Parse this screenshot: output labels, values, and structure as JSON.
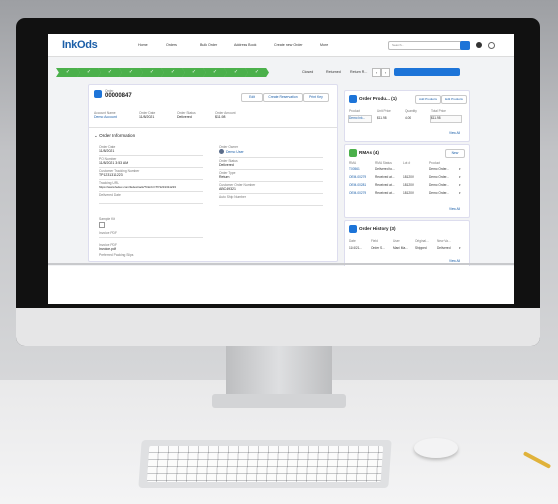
{
  "app": {
    "logo": "InkOds"
  },
  "nav": {
    "items": [
      "Home",
      "Orders",
      "Bulk Order",
      "Address Book",
      "Create new Order",
      "More"
    ],
    "search_placeholder": "Search..."
  },
  "path": {
    "stages": [
      "✓",
      "✓",
      "✓",
      "✓",
      "✓",
      "✓",
      "✓",
      "✓",
      "✓",
      "✓"
    ],
    "status_closed": "Closed",
    "status_returned": "Returned",
    "status_return": "Return R..."
  },
  "order": {
    "object_label": "Order",
    "number": "00000847",
    "actions": [
      "Edit",
      "Create Reservation",
      "Print Key"
    ],
    "account_name_label": "Account Name",
    "account_name": "Demo Account",
    "order_date_label": "Order Date",
    "order_date": "11/8/2021",
    "order_status_label": "Order Status",
    "order_status": "Delivered",
    "order_amount_label": "Order Amount",
    "order_amount": "$11.98"
  },
  "order_info": {
    "section_title": "Order Information",
    "order_date_label": "Order Date",
    "order_date": "11/8/2021",
    "po_number_label": "PO Number",
    "po_number": "11/8/2021 3:53 AM",
    "tracking_label": "Customer Tracking Number",
    "tracking": "TP1231311223",
    "tracking_url_label": "Tracking URL",
    "tracking_url": "https://www.fedex.com/fedextrack/?trknbr=TP1231311223",
    "delivered_date_label": "Delivered Date",
    "order_owner_label": "Order Owner",
    "order_owner": "Demo User",
    "order_status_label": "Order Status",
    "order_status": "Delivered",
    "order_type_label": "Order Type",
    "order_type": "Return",
    "customer_order_label": "Customer Order Number",
    "customer_order": "ABC49321",
    "auto_ship_label": "Auto Ship Number",
    "sample_label": "Sample Kit",
    "invoice_pdf_label": "Invoice PDF",
    "invoice_pdf": "Invoice.pdf",
    "packing_slip_label": "Preferred Packing Slips"
  },
  "products": {
    "title": "Order Produ... (1)",
    "add_button": "Add Products",
    "edit_button": "Edit Products",
    "cols": [
      "Product",
      "Unit Price",
      "Quantity",
      "Total Price"
    ],
    "rows": [
      [
        "Demo Ink...",
        "$11.98",
        "4.00",
        "$11.98"
      ]
    ],
    "view_all": "View All"
  },
  "rmas": {
    "title": "RMAs (4)",
    "new_button": "New",
    "cols": [
      "RMA",
      "RMA Status",
      "Lot #",
      "Product"
    ],
    "rows": [
      [
        "T00561",
        "Delivered to...",
        "",
        "Demo Order..."
      ],
      [
        "OEM-00279",
        "Received at...",
        "18120V",
        "Demo Order..."
      ],
      [
        "OEM-00281",
        "Received at...",
        "18120V",
        "Demo Order..."
      ],
      [
        "OEM-00279",
        "Received at...",
        "18120V",
        "Demo Order..."
      ]
    ],
    "view_all": "View All"
  },
  "history": {
    "title": "Order History (3)",
    "cols": [
      "Date",
      "Field",
      "User",
      "Original...",
      "New Va..."
    ],
    "rows": [
      [
        "11/4/21...",
        "Order S...",
        "Mani Ma...",
        "Shipped",
        "Delivered"
      ]
    ],
    "view_all": "View All"
  },
  "colors": {
    "accent": "#1d74d8",
    "path_green": "#4bb04b",
    "brand": "#1a5ea8"
  }
}
